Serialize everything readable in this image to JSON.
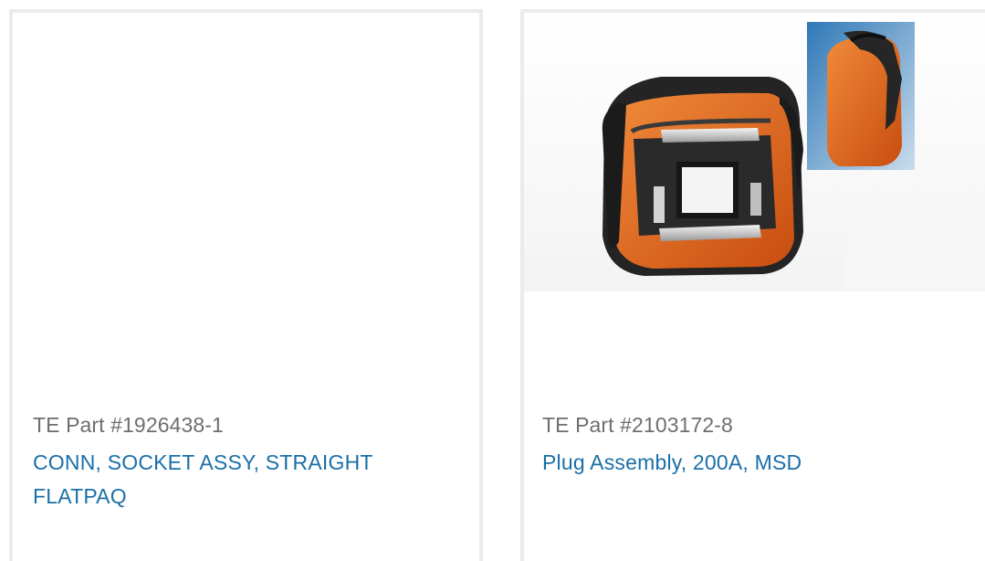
{
  "products": [
    {
      "part_number": "TE Part #1926438-1",
      "description": "CONN, SOCKET ASSY, STRAIGHT FLATPAQ",
      "image": "blank"
    },
    {
      "part_number": "TE Part #2103172-8",
      "description": "Plug Assembly, 200A, MSD",
      "image": "orange-black-connector-plug-assembly"
    }
  ],
  "colors": {
    "link": "#1a6fa8",
    "part_text": "#6e6e6e",
    "card_border": "#ebebeb",
    "connector_orange": "#e2661e",
    "connector_black": "#262626"
  }
}
